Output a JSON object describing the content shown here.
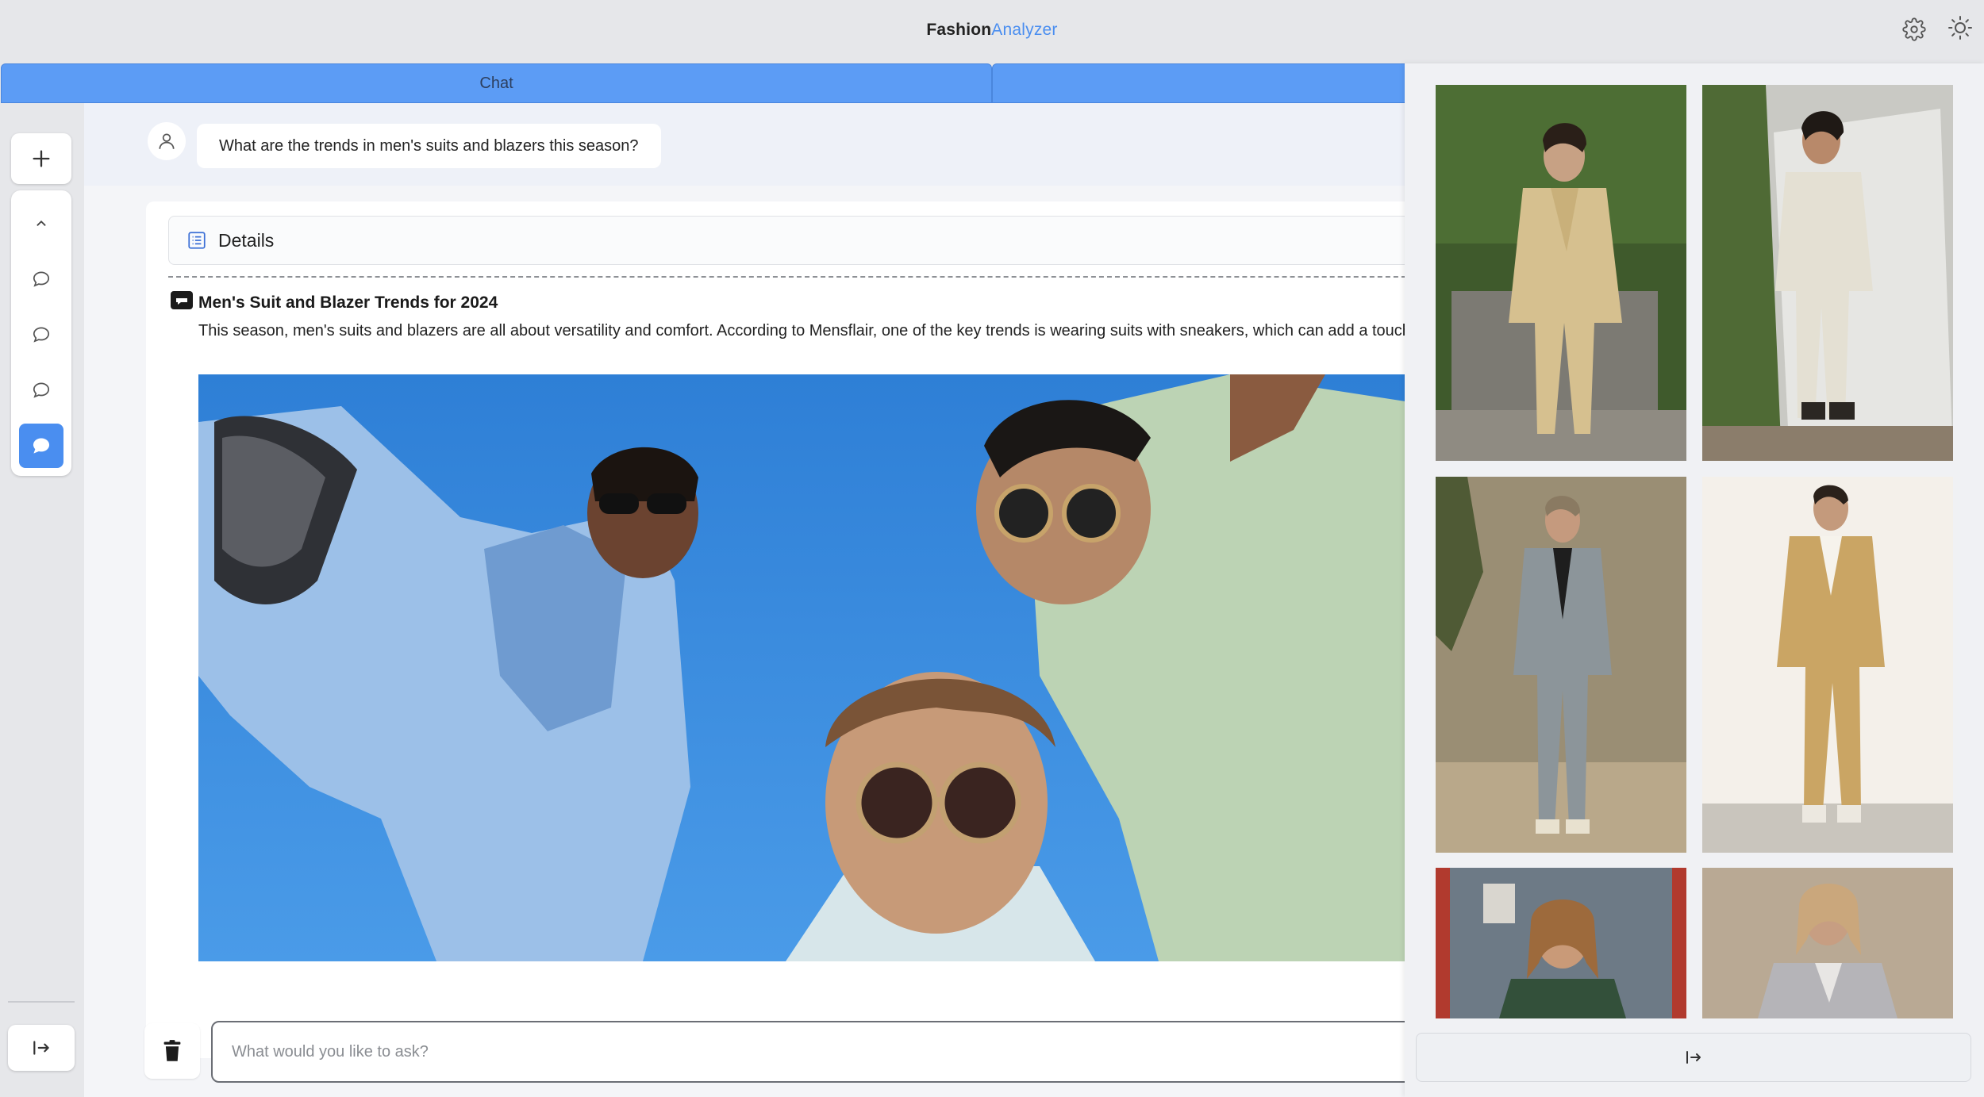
{
  "app": {
    "title_part1": "Fashion",
    "title_part2": "Analyzer"
  },
  "header": {
    "icons": [
      "gear-icon",
      "sun-icon"
    ]
  },
  "tabs": [
    {
      "label": "Chat",
      "active": true
    },
    {
      "label": ""
    }
  ],
  "sidebar": {
    "icons": [
      "plus-icon",
      "chevron-up-icon",
      "chat-bubble-icon",
      "chat-bubble-icon",
      "chat-bubble-icon",
      "chat-bubble-icon",
      "sidebar-toggle-icon"
    ],
    "active_index": 3
  },
  "chat": {
    "user_message": "What are the trends in men's suits and blazers this season?",
    "details_label": "Details",
    "article_title": "Men's Suit and Blazer Trends for 2024",
    "article_body": "This season, men's suits and blazers are all about versatility and comfort. According to Mensflair, one of the key trends is wearing suits with sneakers, which can add a touch"
  },
  "input": {
    "placeholder": "What would you like to ask?",
    "value": ""
  },
  "gallery": {
    "image_count": 6
  },
  "colors": {
    "accent": "#4a8ef0",
    "tab": "#5c9cf5",
    "background": "#e6e7ea"
  }
}
